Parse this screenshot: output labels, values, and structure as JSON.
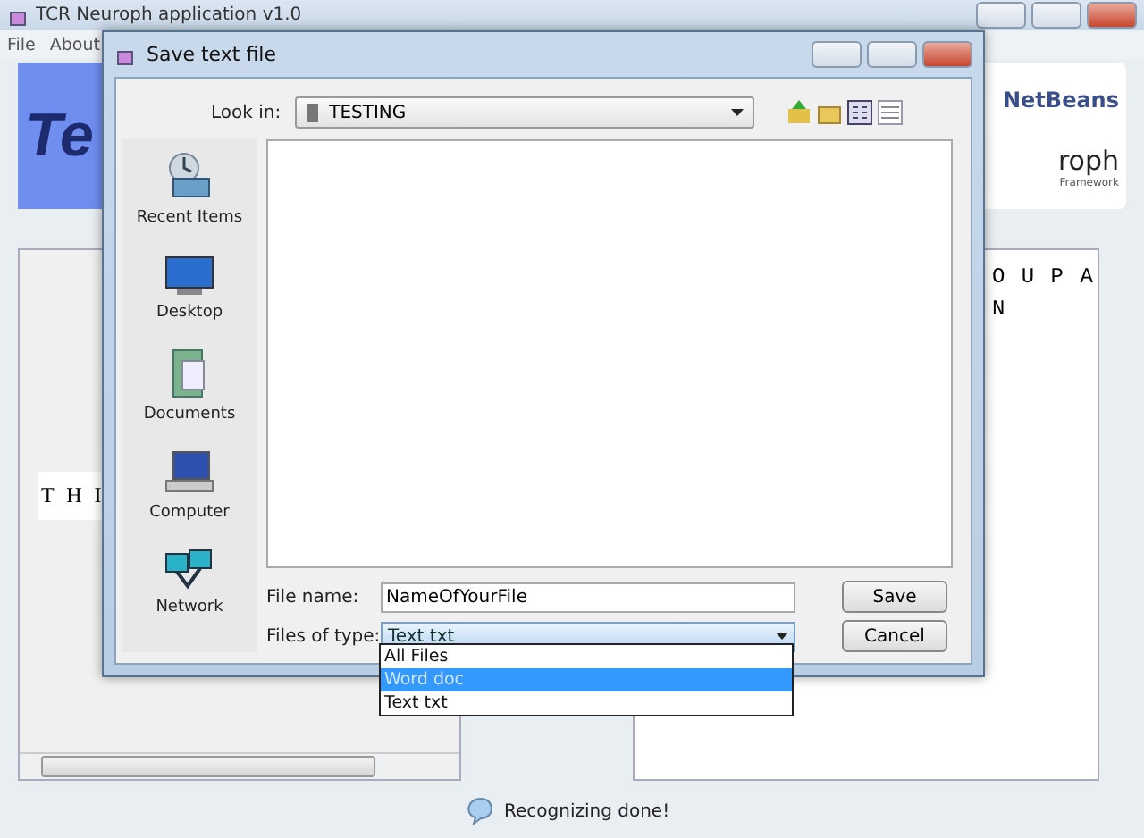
{
  "app": {
    "title": "TCR Neuroph application v1.0",
    "menu": [
      "File",
      "About"
    ],
    "banner": {
      "logo_text": "Te",
      "netbeans_text": "NetBeans",
      "neuroph_text": "roph",
      "neuroph_tagline": "Framework"
    },
    "left_panel": {
      "text": "T H I"
    },
    "right_panel": {
      "lines": [
        "O U P A",
        "N"
      ]
    },
    "status": "Recognizing done!"
  },
  "dialog": {
    "title": "Save text file",
    "look_in": {
      "label": "Look in:",
      "value": "TESTING"
    },
    "places": [
      {
        "label": "Recent Items",
        "kind": "recent"
      },
      {
        "label": "Desktop",
        "kind": "desktop"
      },
      {
        "label": "Documents",
        "kind": "documents"
      },
      {
        "label": "Computer",
        "kind": "computer"
      },
      {
        "label": "Network",
        "kind": "network"
      }
    ],
    "file_name": {
      "label": "File name:",
      "value": "NameOfYourFile"
    },
    "file_type": {
      "label": "Files of type:",
      "value": "Text txt",
      "expanded": true,
      "options": [
        {
          "label": "All Files",
          "highlighted": false
        },
        {
          "label": "Word doc",
          "highlighted": true
        },
        {
          "label": "Text txt",
          "highlighted": false
        }
      ]
    },
    "buttons": [
      "Save",
      "Cancel"
    ]
  }
}
